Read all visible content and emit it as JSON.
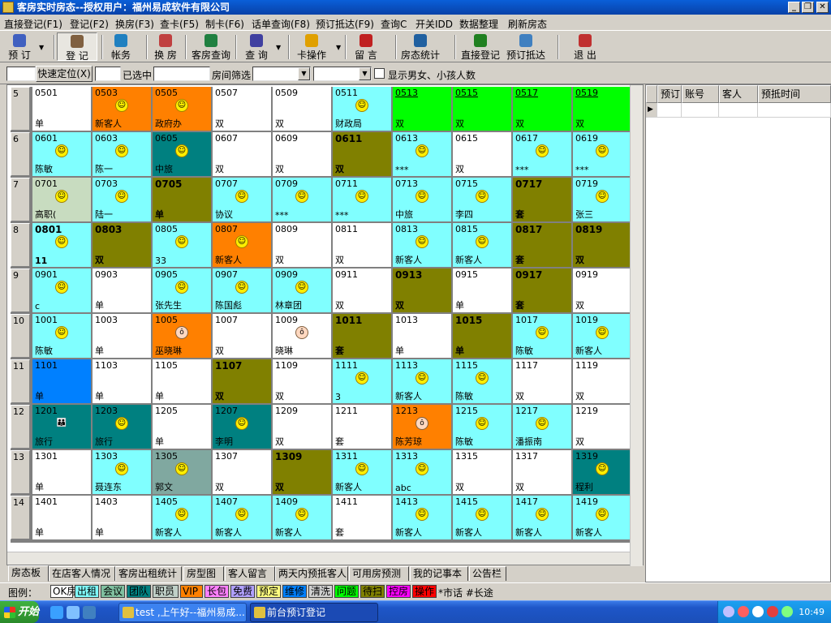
{
  "window": {
    "title": "客房实时房态--授权用户：福州易成软件有限公司"
  },
  "menu": [
    "直接登记(F1)",
    "登记(F2)",
    "换房(F3)",
    "查卡(F5)",
    "制卡(F6)",
    "话单查询(F8)",
    "预订抵达(F9)",
    "查询C",
    "开关IDD",
    "数据整理",
    "刷新房态"
  ],
  "toolbar": [
    {
      "label": "预 订",
      "icon": "booking-icon"
    },
    {
      "label": "登 记",
      "icon": "checkin-icon"
    },
    {
      "label": "帐务",
      "icon": "accounting-icon"
    },
    {
      "label": "换 房",
      "icon": "change-room-icon"
    },
    {
      "label": "客房查询",
      "icon": "room-query-icon"
    },
    {
      "label": "查 询",
      "icon": "query-icon"
    },
    {
      "label": "卡操作",
      "icon": "card-icon"
    },
    {
      "label": "留 言",
      "icon": "message-icon"
    },
    {
      "label": "房态统计",
      "icon": "statistics-icon"
    },
    {
      "label": "直接登记",
      "icon": "direct-checkin-icon"
    },
    {
      "label": "预订抵达",
      "icon": "arrival-icon"
    },
    {
      "label": "退 出",
      "icon": "exit-icon"
    }
  ],
  "filters": {
    "locate_button": "快速定位(X)",
    "selected_label": "已选中",
    "room_filter_label": "房间筛选",
    "show_gender_label": "显示男女、小孩人数"
  },
  "colors": {
    "cyan": "#80ffff",
    "white": "#ffffff",
    "orange": "#ff8000",
    "olive": "#808000",
    "teal": "#008080",
    "green": "#00ff00",
    "blue": "#0080ff",
    "gray": "#80a8a0",
    "lightgreen": "#c8dcc0"
  },
  "floors": [
    {
      "label": "5",
      "rooms": [
        {
          "num": "0501",
          "guest": "单",
          "color": "white",
          "icon": ""
        },
        {
          "num": "0503",
          "guest": "新客人",
          "color": "orange",
          "icon": "smile"
        },
        {
          "num": "0505",
          "guest": "政府办",
          "color": "orange",
          "icon": "smile"
        },
        {
          "num": "0507",
          "guest": "双",
          "color": "white",
          "icon": ""
        },
        {
          "num": "0509",
          "guest": "双",
          "color": "white",
          "icon": ""
        },
        {
          "num": "0511",
          "guest": "财政局",
          "color": "cyan",
          "icon": "smile"
        },
        {
          "num": "0513",
          "guest": "双",
          "color": "green",
          "icon": "",
          "ul": true
        },
        {
          "num": "0515",
          "guest": "双",
          "color": "green",
          "icon": "",
          "ul": true
        },
        {
          "num": "0517",
          "guest": "双",
          "color": "green",
          "icon": "",
          "ul": true
        },
        {
          "num": "0519",
          "guest": "双",
          "color": "green",
          "icon": "",
          "ul": true
        }
      ]
    },
    {
      "label": "6",
      "rooms": [
        {
          "num": "0601",
          "guest": "陈敏",
          "color": "cyan",
          "icon": "smile"
        },
        {
          "num": "0603",
          "guest": "陈一",
          "color": "cyan",
          "icon": "smile"
        },
        {
          "num": "0605",
          "guest": "中旅",
          "color": "teal",
          "icon": "smile"
        },
        {
          "num": "0607",
          "guest": "双",
          "color": "white",
          "icon": ""
        },
        {
          "num": "0609",
          "guest": "双",
          "color": "white",
          "icon": ""
        },
        {
          "num": "0611",
          "guest": "双",
          "color": "olive",
          "icon": "",
          "big": true
        },
        {
          "num": "0613",
          "guest": "***",
          "color": "cyan",
          "icon": "smile"
        },
        {
          "num": "0615",
          "guest": "双",
          "color": "white",
          "icon": ""
        },
        {
          "num": "0617",
          "guest": "***",
          "color": "cyan",
          "icon": "smile"
        },
        {
          "num": "0619",
          "guest": "***",
          "color": "cyan",
          "icon": "smile"
        }
      ]
    },
    {
      "label": "7",
      "rooms": [
        {
          "num": "0701",
          "guest": "高职(",
          "color": "lightgreen",
          "icon": "smile"
        },
        {
          "num": "0703",
          "guest": "陆一",
          "color": "cyan",
          "icon": "smile"
        },
        {
          "num": "0705",
          "guest": "单",
          "color": "olive",
          "icon": "",
          "big": true
        },
        {
          "num": "0707",
          "guest": "协议",
          "color": "cyan",
          "icon": "smile"
        },
        {
          "num": "0709",
          "guest": "***",
          "color": "cyan",
          "icon": "smile"
        },
        {
          "num": "0711",
          "guest": "***",
          "color": "cyan",
          "icon": "smile"
        },
        {
          "num": "0713",
          "guest": "中旅",
          "color": "cyan",
          "icon": "smile"
        },
        {
          "num": "0715",
          "guest": "李四",
          "color": "cyan",
          "icon": "smile"
        },
        {
          "num": "0717",
          "guest": "套",
          "color": "olive",
          "icon": "",
          "big": true
        },
        {
          "num": "0719",
          "guest": "张三",
          "color": "cyan",
          "icon": "smile"
        }
      ]
    },
    {
      "label": "8",
      "rooms": [
        {
          "num": "0801",
          "guest": "11",
          "color": "cyan",
          "icon": "smile",
          "big": true
        },
        {
          "num": "0803",
          "guest": "双",
          "color": "olive",
          "icon": "",
          "big": true
        },
        {
          "num": "0805",
          "guest": "33",
          "color": "cyan",
          "icon": "smile"
        },
        {
          "num": "0807",
          "guest": "新客人",
          "color": "orange",
          "icon": "smile"
        },
        {
          "num": "0809",
          "guest": "双",
          "color": "white",
          "icon": ""
        },
        {
          "num": "0811",
          "guest": "双",
          "color": "white",
          "icon": ""
        },
        {
          "num": "0813",
          "guest": "新客人",
          "color": "cyan",
          "icon": "smile"
        },
        {
          "num": "0815",
          "guest": "新客人",
          "color": "cyan",
          "icon": "smile"
        },
        {
          "num": "0817",
          "guest": "套",
          "color": "olive",
          "icon": "",
          "big": true
        },
        {
          "num": "0819",
          "guest": "双",
          "color": "olive",
          "icon": "",
          "big": true
        }
      ]
    },
    {
      "label": "9",
      "rooms": [
        {
          "num": "0901",
          "guest": "c",
          "color": "cyan",
          "icon": "smile"
        },
        {
          "num": "0903",
          "guest": "单",
          "color": "white",
          "icon": ""
        },
        {
          "num": "0905",
          "guest": "张先生",
          "color": "cyan",
          "icon": "smile"
        },
        {
          "num": "0907",
          "guest": "陈国彪",
          "color": "cyan",
          "icon": "smile"
        },
        {
          "num": "0909",
          "guest": "林章团",
          "color": "cyan",
          "icon": "smile"
        },
        {
          "num": "0911",
          "guest": "双",
          "color": "white",
          "icon": ""
        },
        {
          "num": "0913",
          "guest": "双",
          "color": "olive",
          "icon": "",
          "big": true
        },
        {
          "num": "0915",
          "guest": "单",
          "color": "white",
          "icon": ""
        },
        {
          "num": "0917",
          "guest": "套",
          "color": "olive",
          "icon": "",
          "big": true
        },
        {
          "num": "0919",
          "guest": "双",
          "color": "white",
          "icon": ""
        }
      ]
    },
    {
      "label": "10",
      "rooms": [
        {
          "num": "1001",
          "guest": "陈敏",
          "color": "cyan",
          "icon": "smile"
        },
        {
          "num": "1003",
          "guest": "单",
          "color": "white",
          "icon": ""
        },
        {
          "num": "1005",
          "guest": "巫晓琳",
          "color": "orange",
          "icon": "woman"
        },
        {
          "num": "1007",
          "guest": "双",
          "color": "white",
          "icon": ""
        },
        {
          "num": "1009",
          "guest": "晓琳",
          "color": "white",
          "icon": "woman"
        },
        {
          "num": "1011",
          "guest": "套",
          "color": "olive",
          "icon": "",
          "big": true
        },
        {
          "num": "1013",
          "guest": "单",
          "color": "white",
          "icon": ""
        },
        {
          "num": "1015",
          "guest": "单",
          "color": "olive",
          "icon": "",
          "big": true
        },
        {
          "num": "1017",
          "guest": "陈敏",
          "color": "cyan",
          "icon": "smile"
        },
        {
          "num": "1019",
          "guest": "新客人",
          "color": "cyan",
          "icon": "smile"
        }
      ]
    },
    {
      "label": "11",
      "rooms": [
        {
          "num": "1101",
          "guest": "单",
          "color": "blue",
          "icon": ""
        },
        {
          "num": "1103",
          "guest": "单",
          "color": "white",
          "icon": ""
        },
        {
          "num": "1105",
          "guest": "单",
          "color": "white",
          "icon": ""
        },
        {
          "num": "1107",
          "guest": "双",
          "color": "olive",
          "icon": "",
          "big": true
        },
        {
          "num": "1109",
          "guest": "双",
          "color": "white",
          "icon": ""
        },
        {
          "num": "1111",
          "guest": "3",
          "color": "cyan",
          "icon": "smile"
        },
        {
          "num": "1113",
          "guest": "新客人",
          "color": "cyan",
          "icon": "smile"
        },
        {
          "num": "1115",
          "guest": "陈敏",
          "color": "cyan",
          "icon": "smile"
        },
        {
          "num": "1117",
          "guest": "双",
          "color": "white",
          "icon": ""
        },
        {
          "num": "1119",
          "guest": "双",
          "color": "white",
          "icon": ""
        }
      ]
    },
    {
      "label": "12",
      "rooms": [
        {
          "num": "1201",
          "guest": "旅行",
          "color": "teal",
          "icon": "family"
        },
        {
          "num": "1203",
          "guest": "旅行",
          "color": "teal",
          "icon": "smile"
        },
        {
          "num": "1205",
          "guest": "单",
          "color": "white",
          "icon": ""
        },
        {
          "num": "1207",
          "guest": "李明",
          "color": "teal",
          "icon": "smile"
        },
        {
          "num": "1209",
          "guest": "双",
          "color": "white",
          "icon": ""
        },
        {
          "num": "1211",
          "guest": "套",
          "color": "white",
          "icon": ""
        },
        {
          "num": "1213",
          "guest": "陈芳琼",
          "color": "orange",
          "icon": "woman"
        },
        {
          "num": "1215",
          "guest": "陈敏",
          "color": "cyan",
          "icon": "smile"
        },
        {
          "num": "1217",
          "guest": "潘振南",
          "color": "cyan",
          "icon": "smile"
        },
        {
          "num": "1219",
          "guest": "双",
          "color": "white",
          "icon": ""
        }
      ]
    },
    {
      "label": "13",
      "rooms": [
        {
          "num": "1301",
          "guest": "单",
          "color": "white",
          "icon": ""
        },
        {
          "num": "1303",
          "guest": "聂连东",
          "color": "cyan",
          "icon": "smile"
        },
        {
          "num": "1305",
          "guest": "郭文",
          "color": "gray",
          "icon": "smile"
        },
        {
          "num": "1307",
          "guest": "双",
          "color": "white",
          "icon": ""
        },
        {
          "num": "1309",
          "guest": "双",
          "color": "olive",
          "icon": "",
          "big": true
        },
        {
          "num": "1311",
          "guest": "新客人",
          "color": "cyan",
          "icon": "smile"
        },
        {
          "num": "1313",
          "guest": "abc",
          "color": "cyan",
          "icon": "smile"
        },
        {
          "num": "1315",
          "guest": "双",
          "color": "white",
          "icon": ""
        },
        {
          "num": "1317",
          "guest": "双",
          "color": "white",
          "icon": ""
        },
        {
          "num": "1319",
          "guest": "程利",
          "color": "teal",
          "icon": "smile"
        }
      ]
    },
    {
      "label": "14",
      "rooms": [
        {
          "num": "1401",
          "guest": "单",
          "color": "white",
          "icon": ""
        },
        {
          "num": "1403",
          "guest": "单",
          "color": "white",
          "icon": ""
        },
        {
          "num": "1405",
          "guest": "新客人",
          "color": "cyan",
          "icon": "smile"
        },
        {
          "num": "1407",
          "guest": "新客人",
          "color": "cyan",
          "icon": "smile"
        },
        {
          "num": "1409",
          "guest": "新客人",
          "color": "cyan",
          "icon": "smile"
        },
        {
          "num": "1411",
          "guest": "套",
          "color": "white",
          "icon": ""
        },
        {
          "num": "1413",
          "guest": "新客人",
          "color": "cyan",
          "icon": "smile"
        },
        {
          "num": "1415",
          "guest": "新客人",
          "color": "cyan",
          "icon": "smile"
        },
        {
          "num": "1417",
          "guest": "新客人",
          "color": "cyan",
          "icon": "smile"
        },
        {
          "num": "1419",
          "guest": "新客人",
          "color": "cyan",
          "icon": "smile"
        }
      ]
    }
  ],
  "side_table": {
    "columns": [
      "预订!",
      "账号",
      "客人",
      "预抵时间"
    ]
  },
  "tabs": [
    "房态板",
    "在店客人情况",
    "客房出租统计",
    "房型图",
    "客人留言",
    "两天内预抵客人",
    "可用房预测",
    "我的记事本",
    "公告栏"
  ],
  "legend": {
    "label": "图例：",
    "items": [
      {
        "text": "OK房",
        "bg": "#ffffff"
      },
      {
        "text": "出租",
        "bg": "#80ffff"
      },
      {
        "text": "会议",
        "bg": "#80c0a0"
      },
      {
        "text": "团队",
        "bg": "#008080"
      },
      {
        "text": "职员",
        "bg": "#c0d0c8"
      },
      {
        "text": "VIP",
        "bg": "#ff8000"
      },
      {
        "text": "长包",
        "bg": "#ff80ff"
      },
      {
        "text": "免费",
        "bg": "#b0a0ff"
      },
      {
        "text": "预定",
        "bg": "#ffff80"
      },
      {
        "text": "维修",
        "bg": "#0080ff"
      },
      {
        "text": "清洗",
        "bg": "#d0d0d0"
      },
      {
        "text": "问题",
        "bg": "#00ff00"
      },
      {
        "text": "待扫",
        "bg": "#808000"
      },
      {
        "text": "控房",
        "bg": "#ff00ff"
      },
      {
        "text": "操作",
        "bg": "#ff0000"
      }
    ],
    "extra": "*市话 #长途"
  },
  "taskbar": {
    "start": "开始",
    "tasks": [
      "test ,上午好--福州易成...",
      "前台预订登记"
    ],
    "clock": "10:49"
  }
}
